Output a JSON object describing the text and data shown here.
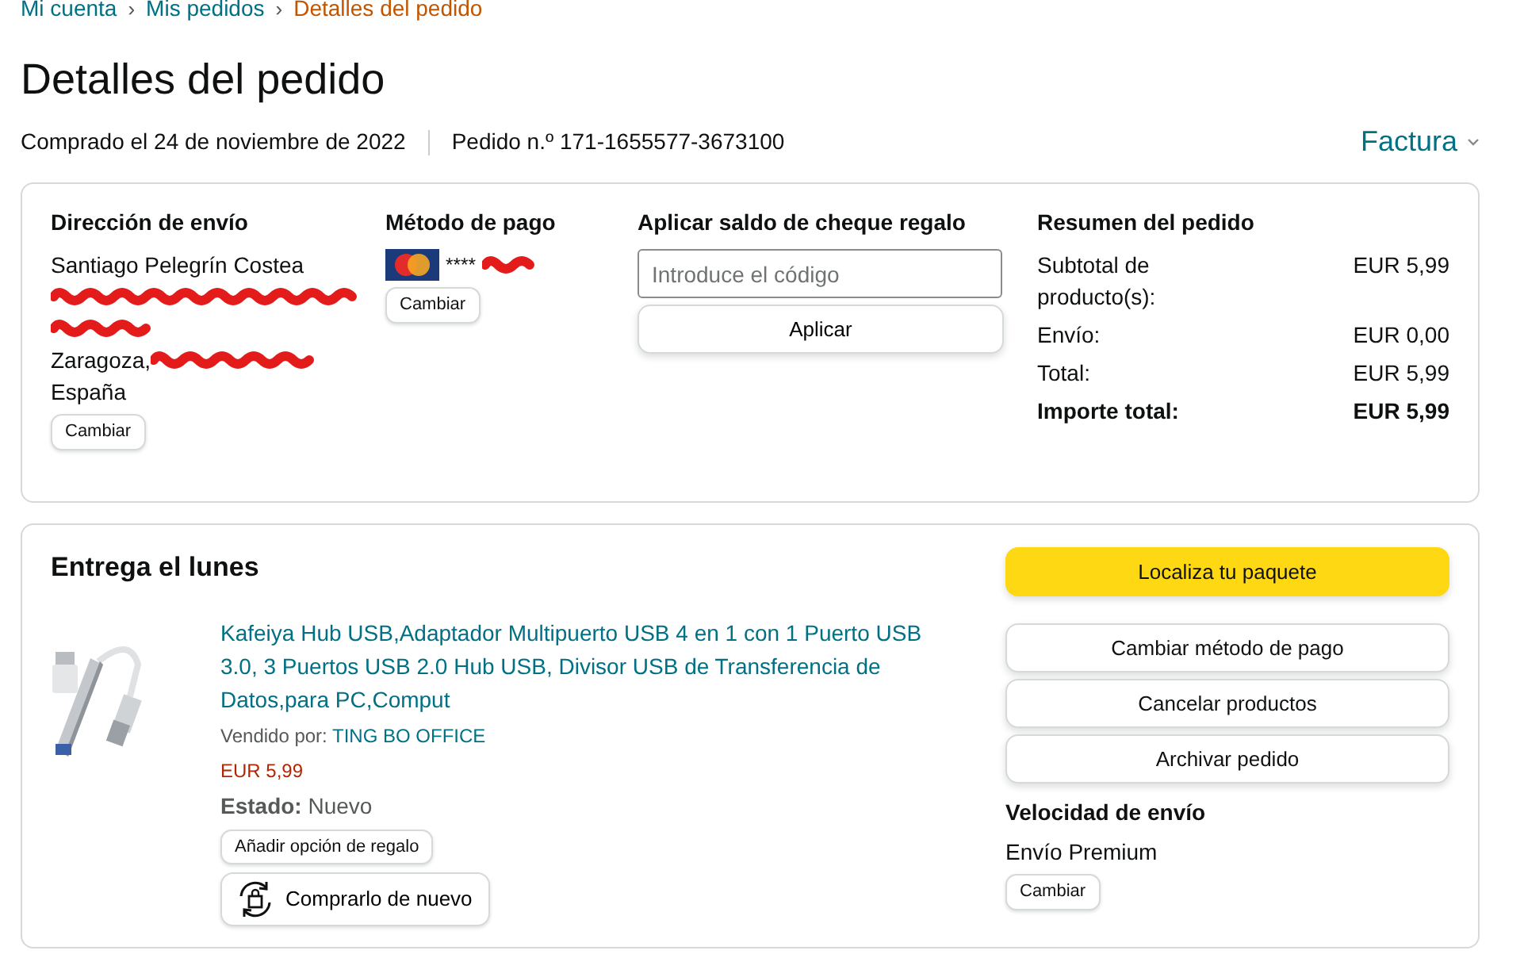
{
  "breadcrumb": [
    {
      "label": "Mi cuenta",
      "current": false
    },
    {
      "label": "Mis pedidos",
      "current": false
    },
    {
      "label": "Detalles del pedido",
      "current": true
    }
  ],
  "breadcrumb_separator": "›",
  "title": "Detalles del pedido",
  "purchased": "Comprado el 24 de noviembre de 2022",
  "order_number": "Pedido n.º 171-1655577-3673100",
  "invoice": "Factura",
  "shipping_address": {
    "heading": "Dirección de envío",
    "lines": [
      {
        "kind": "text",
        "text": "Santiago Pelegrín Costea"
      },
      {
        "kind": "redacted"
      },
      {
        "kind": "redacted"
      },
      {
        "kind": "partly_redacted",
        "text": "Zaragoza,"
      },
      {
        "kind": "text",
        "text": "España"
      }
    ],
    "button": "Cambiar"
  },
  "payment": {
    "heading": "Método de pago",
    "card_mask": "****",
    "redacted": true,
    "button": "Cambiar"
  },
  "gift_card": {
    "heading": "Aplicar saldo de cheque regalo",
    "placeholder": "Introduce el código",
    "button": "Aplicar"
  },
  "summary": {
    "heading": "Resumen del pedido",
    "rows": [
      {
        "label": "Subtotal de producto(s):",
        "amount": "EUR 5,99",
        "bold": false
      },
      {
        "label": "Envío:",
        "amount": "EUR 0,00",
        "bold": false
      },
      {
        "label": "Total:",
        "amount": "EUR 5,99",
        "bold": false
      },
      {
        "label": "Importe total:",
        "amount": "EUR 5,99",
        "bold": true
      }
    ]
  },
  "delivery": {
    "heading": "Entrega el lunes",
    "product": {
      "title": "Kafeiya Hub USB,Adaptador Multipuerto USB 4 en 1 con 1 Puerto USB 3.0, 3 Puertos USB 2.0 Hub USB, Divisor USB de Transferencia de Datos,para PC,Comput",
      "sold_by_label": "Vendido por:",
      "seller": "TING BO OFFICE",
      "price": "EUR 5,99",
      "condition": "**Estado:** Nuevo",
      "gift_button": "Añadir opción de regalo",
      "buy_again_button": "Comprarlo de nuevo"
    },
    "actions": [
      {
        "label": "Localiza tu paquete",
        "primary": true
      },
      {
        "label": "Cambiar método de pago",
        "primary": false
      },
      {
        "label": "Cancelar productos",
        "primary": false
      },
      {
        "label": "Archivar pedido",
        "primary": false
      }
    ],
    "shipping_speed": {
      "heading": "Velocidad de envío",
      "value": "Envío Premium",
      "button": "Cambiar"
    }
  }
}
